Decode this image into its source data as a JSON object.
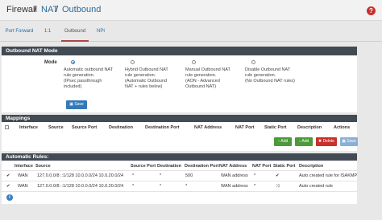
{
  "breadcrumb": {
    "part1": "Firewall",
    "sep1": "/",
    "part2": "NAT",
    "sep2": "/",
    "part3": "Outbound",
    "help": "?"
  },
  "tabs": [
    "Port Forward",
    "1:1",
    "Outbound",
    "NPt"
  ],
  "outbound_mode": {
    "title": "Outbound NAT Mode",
    "label": "Mode",
    "selected": 0,
    "options": [
      {
        "lines": [
          "Automatic outbound NAT",
          "rule generation.",
          "(IPsec passthrough",
          "included)"
        ]
      },
      {
        "lines": [
          "Hybrid Outbound NAT",
          "rule generation.",
          "(Automatic Outbound",
          "NAT + rules below)"
        ]
      },
      {
        "lines": [
          "Manual Outbound NAT",
          "rule generation.",
          "(AON - Advanced",
          "Outbound NAT)"
        ]
      },
      {
        "lines": [
          "Disable Outbound NAT",
          "rule generation.",
          "(No Outbound NAT rules)"
        ]
      }
    ],
    "save_label": "Save"
  },
  "mappings": {
    "title": "Mappings",
    "columns": [
      "Interface",
      "Source",
      "Source Port",
      "Destination",
      "Destination Port",
      "NAT Address",
      "NAT Port",
      "Static Port",
      "Description",
      "Actions"
    ],
    "buttons": {
      "add1": "Add",
      "add2": "Add",
      "delete": "Delete",
      "save": "Save"
    }
  },
  "auto_rules": {
    "title": "Automatic Rules:",
    "columns": [
      "Interface",
      "Source",
      "Source Port",
      "Destination",
      "Destination Port",
      "NAT Address",
      "NAT Port",
      "Static Port",
      "Description"
    ],
    "rows": [
      {
        "check": "✔",
        "interface": "WAN",
        "source": "127.0.0.0/8 ::1/128 10.0.0.0/24 10.0.20.0/24",
        "source_port": "*",
        "destination": "*",
        "destination_port": "500",
        "nat_address": "WAN address",
        "nat_port": "*",
        "static_port": "✔",
        "description": "Auto created rule for ISAKMP"
      },
      {
        "check": "✔",
        "interface": "WAN",
        "source": "127.0.0.0/8 ::1/128 10.0.0.0/24 10.0.20.0/24",
        "source_port": "*",
        "destination": "*",
        "destination_port": "*",
        "nat_address": "WAN address",
        "nat_port": "*",
        "static_port": "⤨",
        "description": "Auto created rule"
      }
    ]
  },
  "info": "i"
}
